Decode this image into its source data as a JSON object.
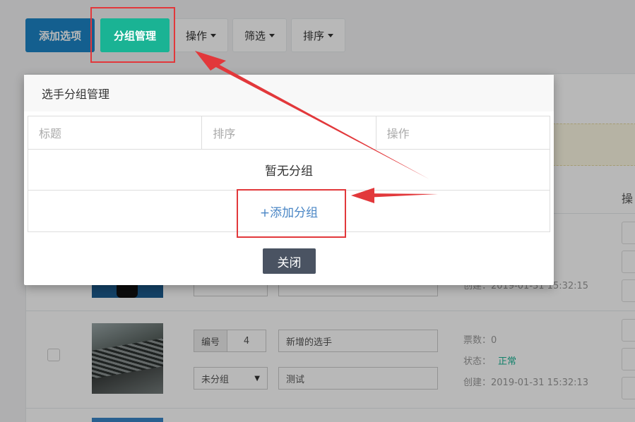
{
  "toolbar": {
    "add_option": "添加选项",
    "group_manage": "分组管理",
    "operate": "操作",
    "filter": "筛选",
    "sort": "排序"
  },
  "table": {
    "operate_header": "操"
  },
  "row1": {
    "meta_created": "创建：2019-01-31 15:32:15"
  },
  "row2": {
    "number_label": "编号",
    "number_value": "4",
    "name_value": "新增的选手",
    "group_value": "未分组",
    "desc_value": "测试",
    "votes": "票数：0",
    "status_label": "状态：",
    "status_value": "正常",
    "created": "创建：2019-01-31 15:32:13"
  },
  "modal": {
    "title": "选手分组管理",
    "columns": [
      "标题",
      "排序",
      "操作"
    ],
    "empty_text": "暂无分组",
    "add_group": "+添加分组",
    "close": "关闭"
  },
  "colors": {
    "primary": "#1c84c6",
    "green": "#1ab394",
    "annotation": "#e2383b",
    "link": "#4a86c5",
    "close_button": "#4a5362"
  }
}
